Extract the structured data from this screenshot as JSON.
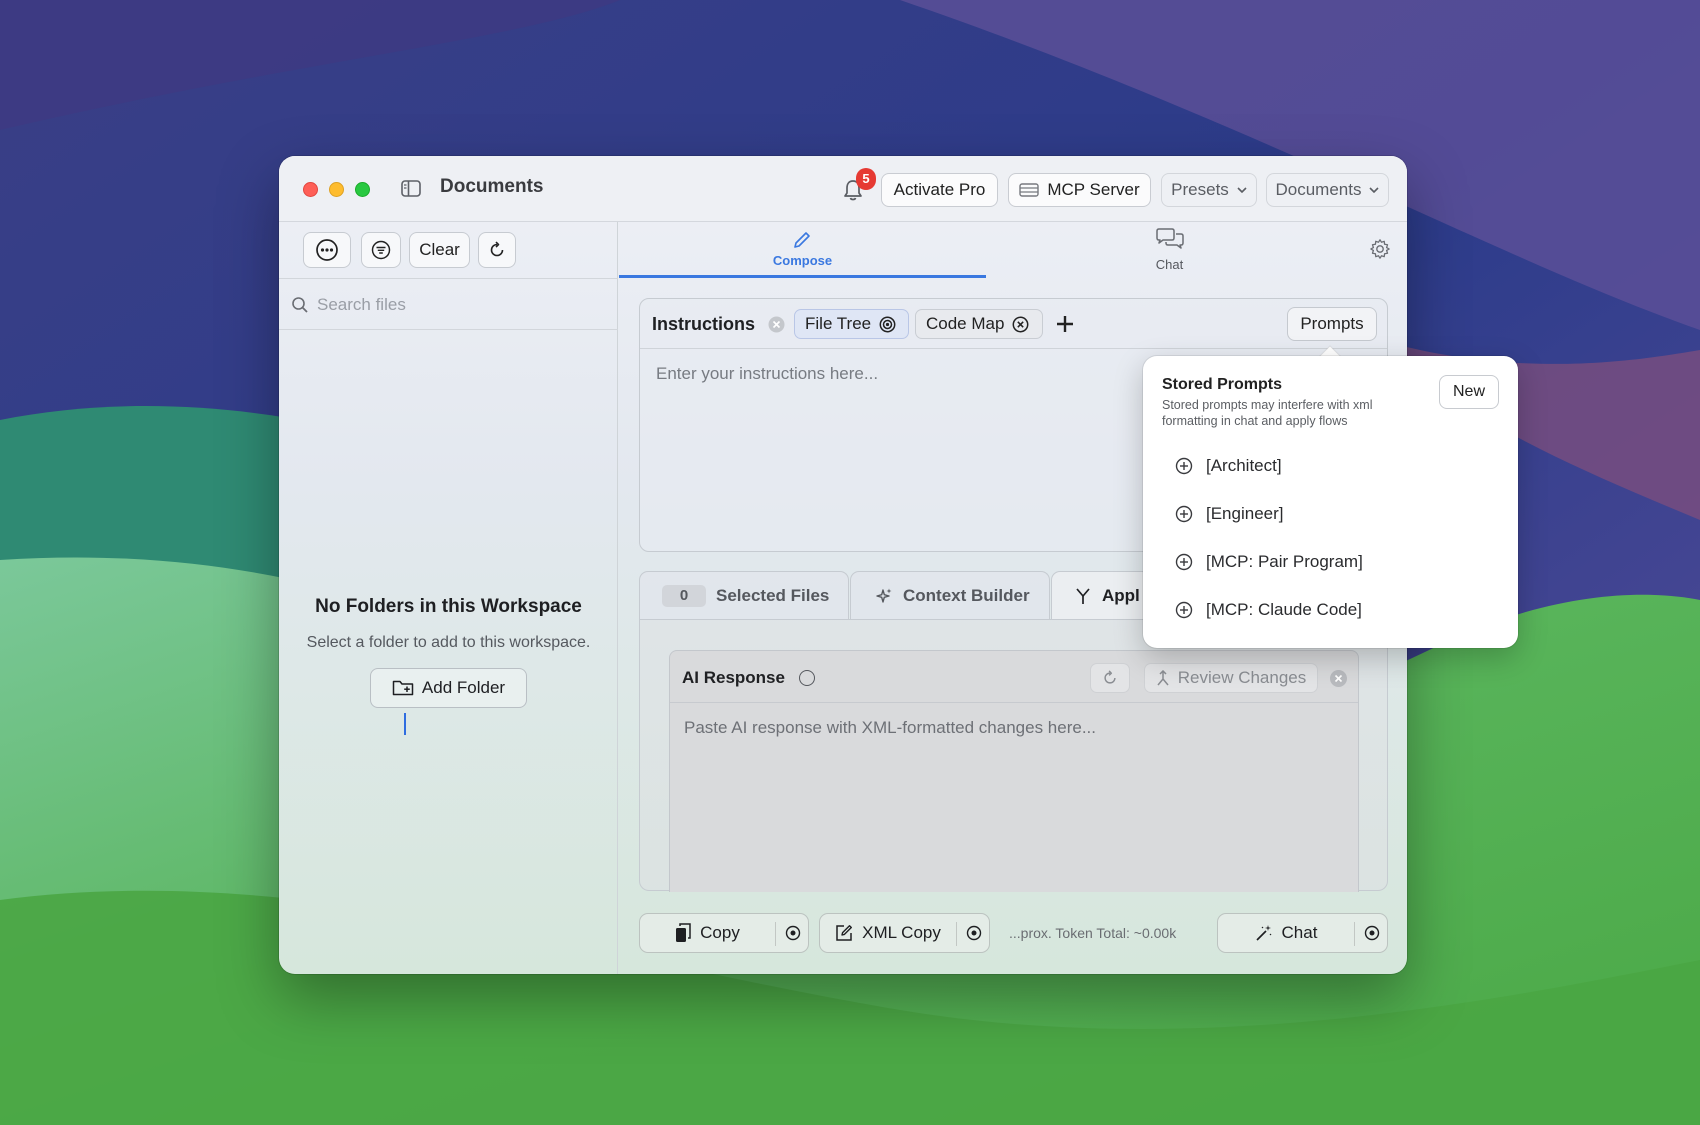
{
  "window": {
    "title": "Documents"
  },
  "titlebar": {
    "notification_count": "5",
    "activate_pro": "Activate Pro",
    "mcp_server": "MCP Server",
    "presets": "Presets",
    "workspace": "Documents"
  },
  "sidebar": {
    "clear": "Clear",
    "search_placeholder": "Search files",
    "empty_title": "No Folders in this Workspace",
    "empty_subtitle": "Select a folder to add to this workspace.",
    "add_folder": "Add Folder"
  },
  "tabs": {
    "compose": "Compose",
    "chat": "Chat"
  },
  "instructions": {
    "title": "Instructions",
    "chips": [
      "File Tree",
      "Code Map"
    ],
    "prompts": "Prompts",
    "placeholder": "Enter your instructions here..."
  },
  "subtabs": {
    "selected_count": "0",
    "selected_files": "Selected Files",
    "context_builder": "Context Builder",
    "apply": "Appl"
  },
  "response": {
    "title": "AI Response",
    "review_changes": "Review Changes",
    "placeholder": "Paste AI response with XML-formatted changes here..."
  },
  "bottom": {
    "copy": "Copy",
    "xml_copy": "XML Copy",
    "token_total": "...prox. Token Total: ~0.00k",
    "chat": "Chat"
  },
  "popover": {
    "title": "Stored Prompts",
    "subtitle": "Stored prompts may interfere with xml formatting in chat and apply flows",
    "new": "New",
    "items": [
      "[Architect]",
      "[Engineer]",
      "[MCP: Pair Program]",
      "[MCP: Claude Code]"
    ]
  },
  "colors": {
    "accent": "#3a78e0",
    "badge": "#e63a33",
    "close": "#fe5f57",
    "minimize": "#febc2e",
    "maximize": "#28c840"
  }
}
